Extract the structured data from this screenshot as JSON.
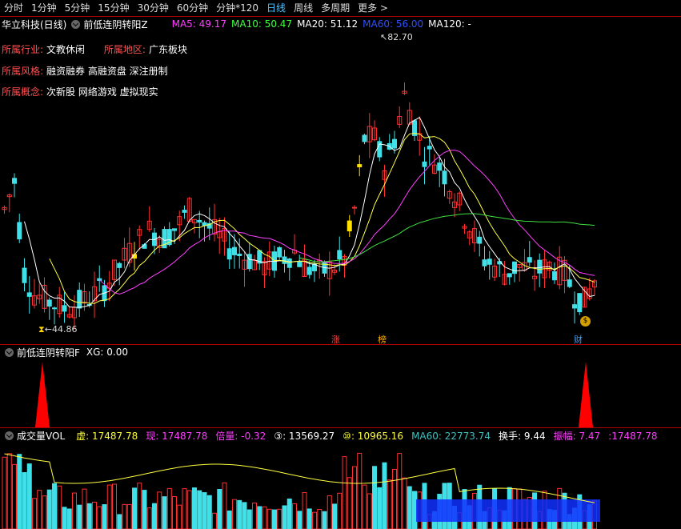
{
  "toolbar": {
    "tabs": [
      "分时",
      "1分钟",
      "5分钟",
      "15分钟",
      "30分钟",
      "60分钟",
      "分钟*120",
      "日线",
      "周线",
      "多周期",
      "更多 >"
    ],
    "active": "日线"
  },
  "main": {
    "title": "华立科技(日线)",
    "indicator": "前低连阴转阳Z",
    "ma": [
      {
        "label": "MA5: 49.17",
        "color": "#ff40ff"
      },
      {
        "label": "MA10: 50.47",
        "color": "#40ff40"
      },
      {
        "label": "MA20: 51.12",
        "color": "#ffffff"
      },
      {
        "label": "MA60: 56.00",
        "color": "#3050ff"
      },
      {
        "label": "MA120: -",
        "color": "#ffffff"
      }
    ],
    "info": [
      {
        "label": "所属行业:",
        "value": "文教休闲",
        "label2": "所属地区:",
        "value2": "广东板块"
      },
      {
        "label": "所属风格:",
        "value": "融资融券 高融资盘 深注册制"
      },
      {
        "label": "所属概念:",
        "value": "次新股 网络游戏 虚拟现实"
      }
    ],
    "high_label": "82.70",
    "low_label": "44.86",
    "markers": [
      "涨",
      "榜",
      "财"
    ]
  },
  "signal": {
    "title": "前低连阴转阳F",
    "xg": "XG: 0.00"
  },
  "volume": {
    "title": "成交量VOL",
    "items": [
      {
        "text": "虚: 17487.78",
        "color": "#ffff40"
      },
      {
        "text": "现: 17487.78",
        "color": "#ff40ff"
      },
      {
        "text": "倍量: -0.32",
        "color": "#ff40ff"
      },
      {
        "text": "③: 13569.27",
        "color": "#ffffff"
      },
      {
        "text": "⑩: 10965.16",
        "color": "#ffff40"
      },
      {
        "text": "MA60: 22773.74",
        "color": "#40c0c0"
      },
      {
        "text": "换手: 9.44",
        "color": "#ffffff"
      },
      {
        "text": "振幅: 7.47",
        "color": "#ff40ff"
      },
      {
        "text": ":17487.78",
        "color": "#ff40ff"
      }
    ]
  },
  "colors": {
    "up": "#ff3030",
    "down": "#40e0e8",
    "limit": "#ffe000",
    "ma5": "#ffffff",
    "ma10": "#ffff40",
    "ma20": "#ff40ff",
    "ma60": "#40e040"
  }
}
